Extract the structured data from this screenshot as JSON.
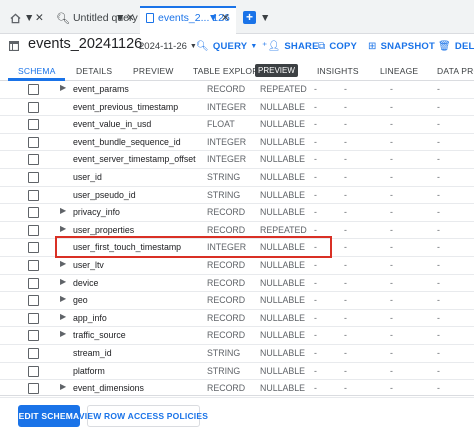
{
  "tabs": {
    "untitled_label": "Untitled query",
    "active_label": "events_2... 126"
  },
  "header": {
    "title": "events_20241126",
    "date": "2024-11-26",
    "actions": {
      "query": "QUERY",
      "share": "SHARE",
      "copy": "COPY",
      "snapshot": "SNAPSHOT",
      "delete": "DELETE"
    }
  },
  "subtabs": {
    "schema": "SCHEMA",
    "details": "DETAILS",
    "preview": "PREVIEW",
    "table_explorer": "TABLE EXPLORER",
    "preview_badge": "PREVIEW",
    "insights": "INSIGHTS",
    "lineage": "LINEAGE",
    "data_profile": "DATA PROF"
  },
  "rows": [
    {
      "name": "event_params",
      "type": "RECORD",
      "mode": "REPEATED",
      "expandable": true
    },
    {
      "name": "event_previous_timestamp",
      "type": "INTEGER",
      "mode": "NULLABLE",
      "expandable": false
    },
    {
      "name": "event_value_in_usd",
      "type": "FLOAT",
      "mode": "NULLABLE",
      "expandable": false
    },
    {
      "name": "event_bundle_sequence_id",
      "type": "INTEGER",
      "mode": "NULLABLE",
      "expandable": false
    },
    {
      "name": "event_server_timestamp_offset",
      "type": "INTEGER",
      "mode": "NULLABLE",
      "expandable": false
    },
    {
      "name": "user_id",
      "type": "STRING",
      "mode": "NULLABLE",
      "expandable": false
    },
    {
      "name": "user_pseudo_id",
      "type": "STRING",
      "mode": "NULLABLE",
      "expandable": false
    },
    {
      "name": "privacy_info",
      "type": "RECORD",
      "mode": "NULLABLE",
      "expandable": true
    },
    {
      "name": "user_properties",
      "type": "RECORD",
      "mode": "REPEATED",
      "expandable": true
    },
    {
      "name": "user_first_touch_timestamp",
      "type": "INTEGER",
      "mode": "NULLABLE",
      "expandable": false
    },
    {
      "name": "user_ltv",
      "type": "RECORD",
      "mode": "NULLABLE",
      "expandable": true
    },
    {
      "name": "device",
      "type": "RECORD",
      "mode": "NULLABLE",
      "expandable": true
    },
    {
      "name": "geo",
      "type": "RECORD",
      "mode": "NULLABLE",
      "expandable": true
    },
    {
      "name": "app_info",
      "type": "RECORD",
      "mode": "NULLABLE",
      "expandable": true
    },
    {
      "name": "traffic_source",
      "type": "RECORD",
      "mode": "NULLABLE",
      "expandable": true
    },
    {
      "name": "stream_id",
      "type": "STRING",
      "mode": "NULLABLE",
      "expandable": false
    },
    {
      "name": "platform",
      "type": "STRING",
      "mode": "NULLABLE",
      "expandable": false
    },
    {
      "name": "event_dimensions",
      "type": "RECORD",
      "mode": "NULLABLE",
      "expandable": true
    }
  ],
  "dash": "-",
  "footer": {
    "edit_schema": "EDIT SCHEMA",
    "row_access": "VIEW ROW ACCESS POLICIES"
  }
}
